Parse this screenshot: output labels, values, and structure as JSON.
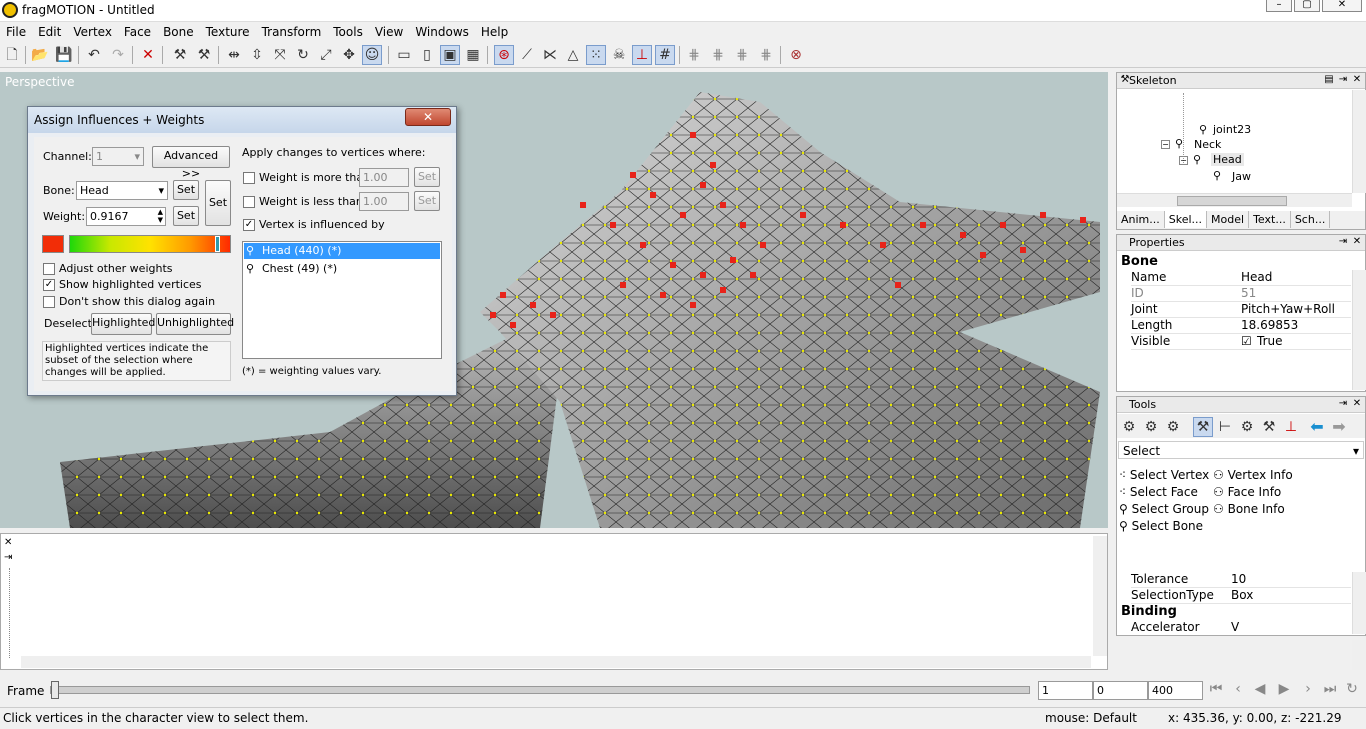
{
  "window": {
    "title": "fragMOTION - Untitled"
  },
  "menu": [
    "File",
    "Edit",
    "Vertex",
    "Face",
    "Bone",
    "Texture",
    "Transform",
    "Tools",
    "View",
    "Windows",
    "Help"
  ],
  "viewport": {
    "label": "Perspective"
  },
  "dialog": {
    "title": "Assign Influences + Weights",
    "channel_label": "Channel:",
    "channel_value": "1",
    "advanced_label": "Advanced >>",
    "bone_label": "Bone:",
    "bone_value": "Head",
    "set_label": "Set",
    "weight_label": "Weight:",
    "weight_value": "0.9167",
    "apply_label": "Apply changes to vertices where:",
    "more_label": "Weight is more than",
    "more_value": "1.00",
    "less_label": "Weight is less than",
    "less_value": "1.00",
    "influenced_label": "Vertex is influenced by",
    "bones": [
      "Head (440) (*)",
      "Chest (49) (*)"
    ],
    "adjust_label": "Adjust other weights",
    "show_highlighted_label": "Show highlighted vertices",
    "dont_show_label": "Don't show this dialog again",
    "deselect_label": "Deselect",
    "highlighted_btn": "Highlighted",
    "unhighlighted_btn": "Unhighlighted",
    "hint": "Highlighted vertices indicate the subset of the selection where changes will be applied.",
    "note": "(*) = weighting values vary."
  },
  "skeleton": {
    "title": "Skeleton",
    "nodes": [
      "joint23",
      "Neck",
      "Head",
      "Jaw"
    ],
    "tabs": [
      "Anim...",
      "Skel...",
      "Model",
      "Text...",
      "Sch..."
    ]
  },
  "properties": {
    "title": "Properties",
    "section": "Bone",
    "rows": [
      {
        "name": "Name",
        "value": "Head"
      },
      {
        "name": "ID",
        "value": "51"
      },
      {
        "name": "Joint",
        "value": "Pitch+Yaw+Roll"
      },
      {
        "name": "Length",
        "value": "18.69853"
      },
      {
        "name": "Visible",
        "value": "True"
      }
    ]
  },
  "tools": {
    "title": "Tools",
    "mode": "Select",
    "left_items": [
      "Select Vertex",
      "Select Face",
      "Select Group",
      "Select Bone"
    ],
    "right_items": [
      "Vertex Info",
      "Face Info",
      "Bone Info"
    ],
    "rows": [
      {
        "name": "Tolerance",
        "value": "10"
      },
      {
        "name": "SelectionType",
        "value": "Box"
      }
    ],
    "section": "Binding",
    "accel_name": "Accelerator",
    "accel_value": "V"
  },
  "frame": {
    "label": "Frame",
    "start": "1",
    "current": "0",
    "end": "400"
  },
  "status": {
    "hint": "Click vertices in the character view to select them.",
    "mouse": "mouse: Default",
    "coords": "x: 435.36, y: 0.00, z: -221.29"
  }
}
